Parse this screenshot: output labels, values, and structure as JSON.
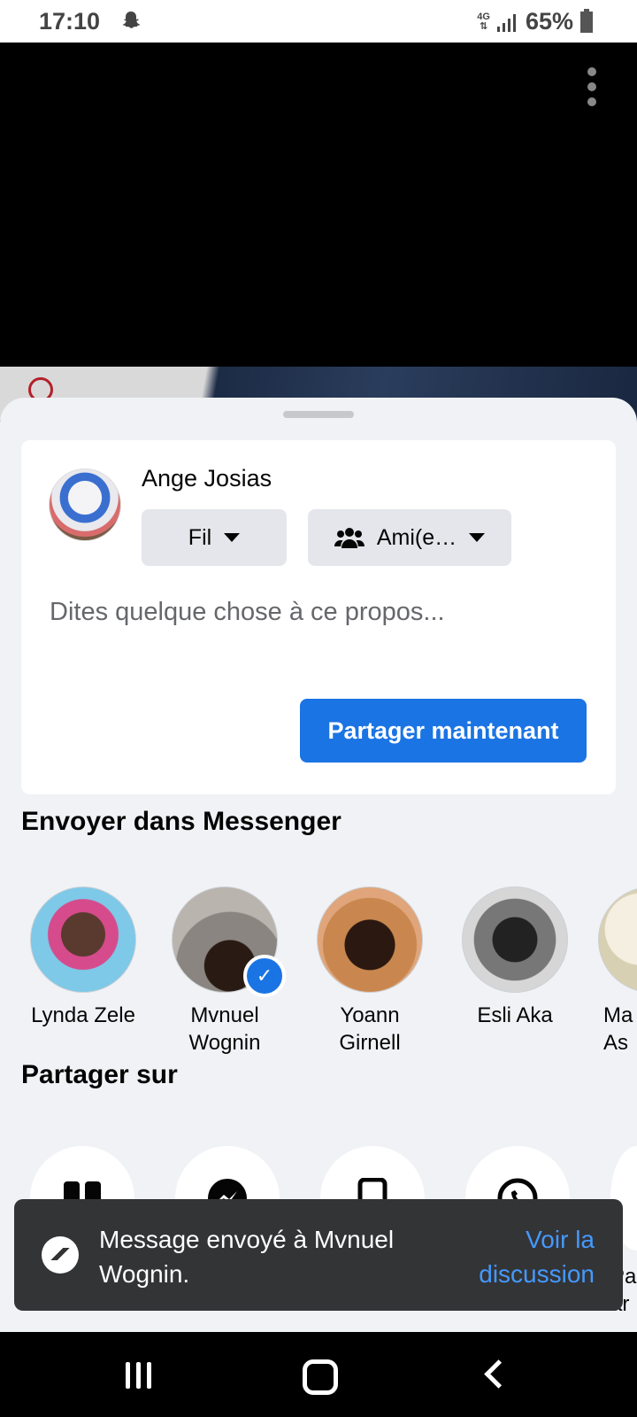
{
  "status_bar": {
    "time": "17:10",
    "network": "4G",
    "battery": "65%"
  },
  "composer": {
    "user_name": "Ange Josias",
    "audience_feed": "Fil",
    "audience_friends": "Ami(e…",
    "placeholder": "Dites quelque chose à ce propos...",
    "share_button": "Partager maintenant"
  },
  "messenger_section": {
    "title": "Envoyer dans Messenger",
    "contacts": [
      {
        "name": "Lynda Zele",
        "color": "#8a4b6e"
      },
      {
        "name": "Mvnuel Wognin",
        "color": "#6f6a64",
        "verified": true
      },
      {
        "name": "Yoann Girnell",
        "color": "#c47a46"
      },
      {
        "name": "Esli Aka",
        "color": "#6a6a6a"
      },
      {
        "name": "Ma As",
        "color": "#e8e2cf"
      }
    ]
  },
  "share_on": {
    "title": "Partager sur"
  },
  "toast": {
    "message": "Message envoyé à Mvnuel Wognin.",
    "action": "Voir la discussion"
  },
  "peek_text": "Pa ar"
}
